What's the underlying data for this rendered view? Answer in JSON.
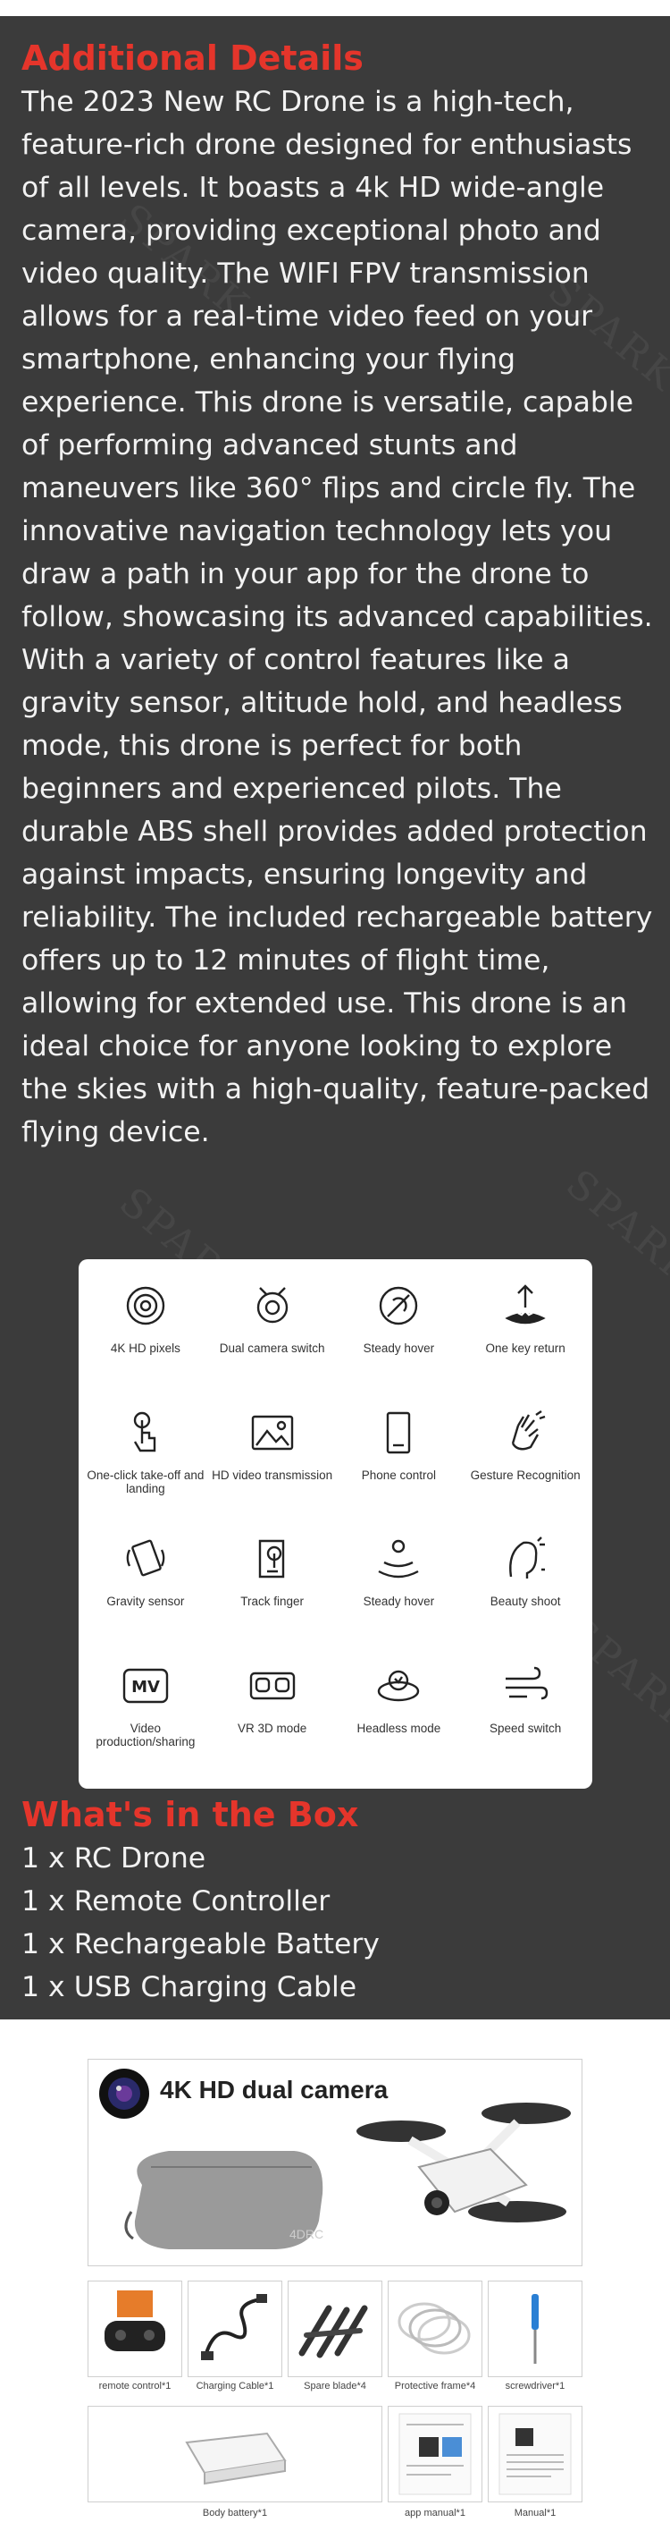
{
  "additional": {
    "title": "Additional Details",
    "body": "The 2023 New RC Drone is a high-tech, feature-rich drone designed for enthusiasts of all levels. It boasts a 4k HD wide-angle camera, providing exceptional photo and video quality. The WIFI FPV transmission allows for a real-time video feed on your smartphone, enhancing your flying experience. This drone is versatile, capable of performing advanced stunts and maneuvers like 360° flips and circle fly. The innovative navigation technology lets you draw a path in your app for the drone to follow, showcasing its advanced capabilities. With a variety of control features like a gravity sensor, altitude hold, and headless mode, this drone is perfect for both beginners and experienced pilots. The durable ABS shell provides added protection against impacts, ensuring longevity and reliability. The included rechargeable battery offers up to 12 minutes of flight time, allowing for extended use. This drone is an ideal choice for anyone looking to explore the skies with a high-quality, feature-packed flying device."
  },
  "features": [
    {
      "label": "4K HD pixels",
      "icon": "camera-lens-icon"
    },
    {
      "label": "Dual camera switch",
      "icon": "dual-camera-icon"
    },
    {
      "label": "Steady hover",
      "icon": "steady-hover-icon"
    },
    {
      "label": "One key return",
      "icon": "home-return-icon"
    },
    {
      "label": "One-click take-off and landing",
      "icon": "tap-finger-icon"
    },
    {
      "label": "HD video transmission",
      "icon": "image-icon"
    },
    {
      "label": "Phone control",
      "icon": "phone-icon"
    },
    {
      "label": "Gesture Recognition",
      "icon": "gesture-hand-icon"
    },
    {
      "label": "Gravity sensor",
      "icon": "gravity-phone-icon"
    },
    {
      "label": "Track finger",
      "icon": "track-map-icon"
    },
    {
      "label": "Steady hover",
      "icon": "hover-signal-icon"
    },
    {
      "label": "Beauty shoot",
      "icon": "beauty-face-icon"
    },
    {
      "label": "Video production/sharing",
      "icon": "mv-icon"
    },
    {
      "label": "VR 3D mode",
      "icon": "vr-goggles-icon"
    },
    {
      "label": "Headless mode",
      "icon": "headless-orbit-icon"
    },
    {
      "label": "Speed switch",
      "icon": "wind-speed-icon"
    }
  ],
  "box": {
    "title": "What's in the Box",
    "items": [
      "1 x RC Drone",
      "1 x Remote Controller",
      "1 x Rechargeable Battery",
      "1 x USB Charging Cable"
    ]
  },
  "gallery": {
    "hero_title": "4K HD dual camera",
    "case_logo": "4DRC",
    "accessories": [
      {
        "label": "remote control*1",
        "icon": "remote-controller-icon"
      },
      {
        "label": "Charging Cable*1",
        "icon": "charging-cable-icon"
      },
      {
        "label": "Spare blade*4",
        "icon": "propeller-blades-icon"
      },
      {
        "label": "Protective frame*4",
        "icon": "protective-frame-icon"
      },
      {
        "label": "screwdriver*1",
        "icon": "screwdriver-icon"
      }
    ],
    "bottom_items": [
      {
        "label": "Body battery*1",
        "icon": "battery-icon"
      },
      {
        "label": "app manual*1",
        "icon": "app-manual-icon"
      },
      {
        "label": "Manual*1",
        "icon": "manual-icon"
      }
    ]
  },
  "colors": {
    "dark_bg": "#3b3b3b",
    "accent_red": "#e5352b",
    "text_light": "#f2f2f2"
  }
}
